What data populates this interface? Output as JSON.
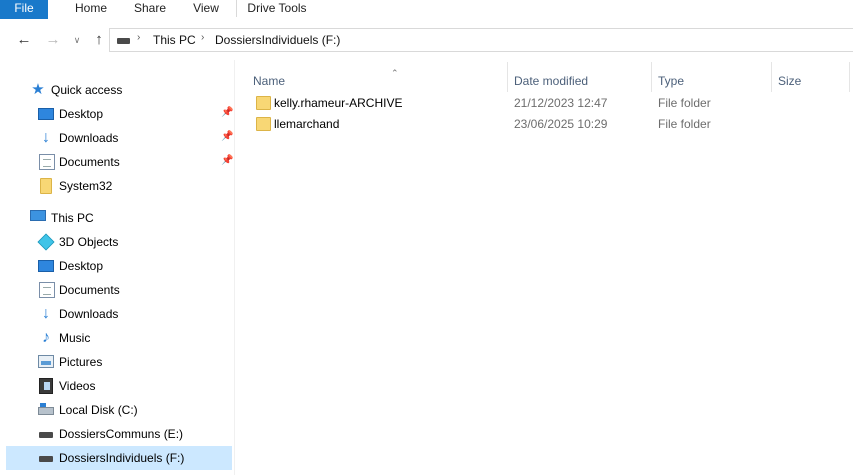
{
  "ribbon": {
    "tabs": [
      "File",
      "Home",
      "Share",
      "View",
      "Drive Tools"
    ]
  },
  "address": {
    "crumbs": [
      "This PC",
      "DossiersIndividuels (F:)"
    ]
  },
  "navigation": {
    "quick_access": "Quick access",
    "quick_items": [
      {
        "label": "Desktop",
        "icon": "desktop-icon",
        "pinned": true
      },
      {
        "label": "Downloads",
        "icon": "downloads-icon",
        "pinned": true
      },
      {
        "label": "Documents",
        "icon": "documents-icon",
        "pinned": true
      },
      {
        "label": "System32",
        "icon": "folder-icon",
        "pinned": false
      }
    ],
    "this_pc": "This PC",
    "pc_items": [
      {
        "label": "3D Objects",
        "icon": "3d-objects-icon"
      },
      {
        "label": "Desktop",
        "icon": "desktop-icon"
      },
      {
        "label": "Documents",
        "icon": "documents-icon"
      },
      {
        "label": "Downloads",
        "icon": "downloads-icon"
      },
      {
        "label": "Music",
        "icon": "music-icon"
      },
      {
        "label": "Pictures",
        "icon": "pictures-icon"
      },
      {
        "label": "Videos",
        "icon": "videos-icon"
      },
      {
        "label": "Local Disk (C:)",
        "icon": "local-disk-icon"
      },
      {
        "label": "DossiersCommuns (E:)",
        "icon": "drive-icon"
      },
      {
        "label": "DossiersIndividuels (F:)",
        "icon": "drive-icon",
        "selected": true
      }
    ]
  },
  "columns": {
    "name": "Name",
    "date": "Date modified",
    "type": "Type",
    "size": "Size"
  },
  "files": [
    {
      "name": "kelly.rhameur-ARCHIVE",
      "date": "21/12/2023 12:47",
      "type": "File folder",
      "size": ""
    },
    {
      "name": "llemarchand",
      "date": "23/06/2025 10:29",
      "type": "File folder",
      "size": ""
    }
  ],
  "colors": {
    "accent": "#1979ca",
    "selection": "#cce8ff",
    "folder": "#f8d775"
  }
}
